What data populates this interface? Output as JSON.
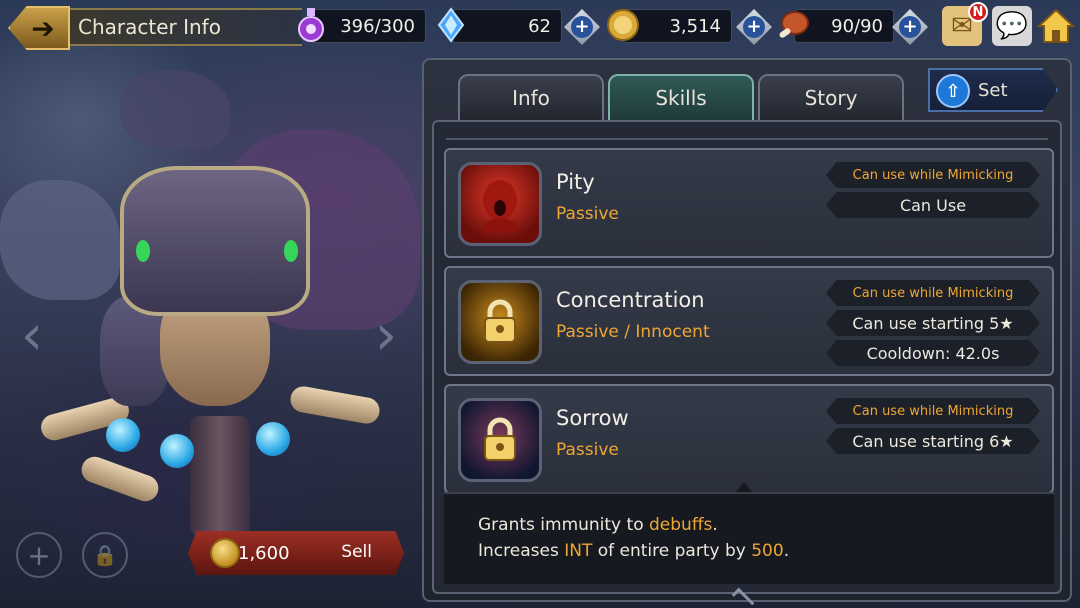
{
  "header": {
    "title": "Character Info"
  },
  "resources": {
    "stamina": "396/300",
    "crystals": "62",
    "gold": "3,514",
    "food": "90/90"
  },
  "mail_badge": "N",
  "tabs": [
    {
      "label": "Info",
      "active": false
    },
    {
      "label": "Skills",
      "active": true
    },
    {
      "label": "Story",
      "active": false
    }
  ],
  "set_label": "Set",
  "sell": {
    "price": "1,600",
    "label": "Sell"
  },
  "skills": [
    {
      "name": "Pity",
      "type": "Passive",
      "icon": "red-face-skill-icon",
      "tags": [
        "Can use while Mimicking",
        "Can Use"
      ]
    },
    {
      "name": "Concentration",
      "type": "Passive / Innocent",
      "icon": "lock-icon",
      "tags": [
        "Can use while Mimicking",
        "Can use starting 5★",
        "Cooldown: 42.0s"
      ]
    },
    {
      "name": "Sorrow",
      "type": "Passive",
      "icon": "lock-icon",
      "tags": [
        "Can use while Mimicking",
        "Can use starting 6★"
      ]
    }
  ],
  "description": {
    "line1_pre": "Grants immunity to ",
    "line1_hl": "debuffs",
    "line1_post": ".",
    "line2_pre": "Increases ",
    "line2_hl1": "INT",
    "line2_mid": " of entire party by ",
    "line2_hl2": "500",
    "line2_post": "."
  },
  "colors": {
    "accent_orange": "#f0a632",
    "active_tab": "#2f5a56",
    "sell_red": "#9c2f24"
  }
}
